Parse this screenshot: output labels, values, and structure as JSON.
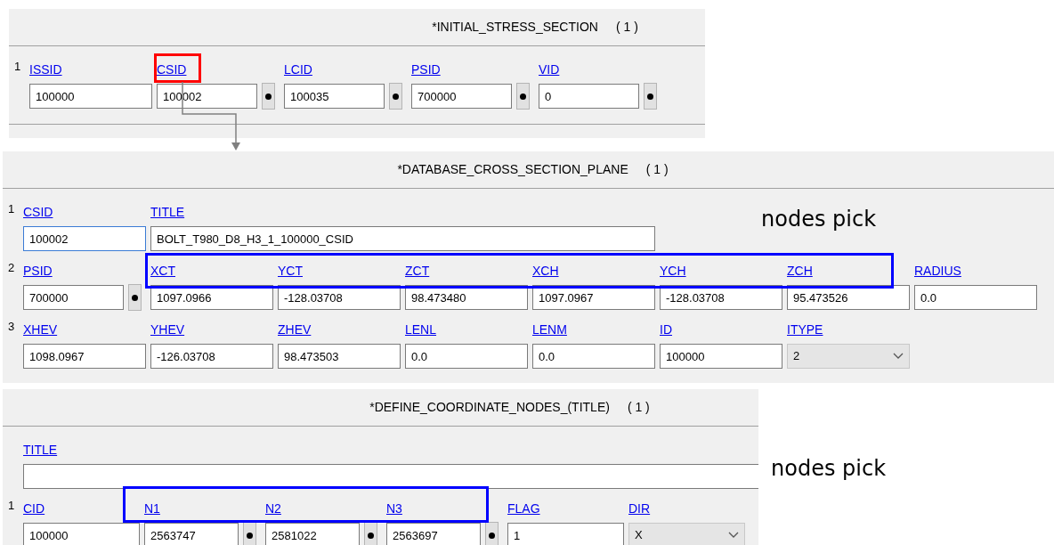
{
  "panels": [
    {
      "title": "*INITIAL_STRESS_SECTION",
      "count": "( 1 )",
      "rows": [
        {
          "number": "1",
          "fields": [
            {
              "label": "ISSID",
              "value": "100000",
              "kind": "text",
              "pick": false
            },
            {
              "label": "CSID",
              "value": "100002",
              "kind": "text",
              "pick": true
            },
            {
              "label": "LCID",
              "value": "100035",
              "kind": "text",
              "pick": true
            },
            {
              "label": "PSID",
              "value": "700000",
              "kind": "text",
              "pick": true
            },
            {
              "label": "VID",
              "value": "0",
              "kind": "text",
              "pick": true
            }
          ]
        }
      ]
    },
    {
      "title": "*DATABASE_CROSS_SECTION_PLANE",
      "count": "( 1 )",
      "rows": [
        {
          "number": "1",
          "fields": [
            {
              "label": "CSID",
              "value": "100002",
              "kind": "text",
              "pick": false,
              "focused": true
            },
            {
              "label": "TITLE",
              "value": "BOLT_T980_D8_H3_1_100000_CSID",
              "kind": "long-text",
              "pick": false
            }
          ]
        },
        {
          "number": "2",
          "fields": [
            {
              "label": "PSID",
              "value": "700000",
              "kind": "text",
              "pick": true
            },
            {
              "label": "XCT",
              "value": "1097.0966",
              "kind": "text",
              "pick": false
            },
            {
              "label": "YCT",
              "value": "-128.03708",
              "kind": "text",
              "pick": false
            },
            {
              "label": "ZCT",
              "value": "98.473480",
              "kind": "text",
              "pick": false
            },
            {
              "label": "XCH",
              "value": "1097.0967",
              "kind": "text",
              "pick": false
            },
            {
              "label": "YCH",
              "value": "-128.03708",
              "kind": "text",
              "pick": false
            },
            {
              "label": "ZCH",
              "value": "95.473526",
              "kind": "text",
              "pick": false
            },
            {
              "label": "RADIUS",
              "value": "0.0",
              "kind": "text",
              "pick": false
            }
          ]
        },
        {
          "number": "3",
          "fields": [
            {
              "label": "XHEV",
              "value": "1098.0967",
              "kind": "text",
              "pick": false
            },
            {
              "label": "YHEV",
              "value": "-126.03708",
              "kind": "text",
              "pick": false
            },
            {
              "label": "ZHEV",
              "value": "98.473503",
              "kind": "text",
              "pick": false
            },
            {
              "label": "LENL",
              "value": "0.0",
              "kind": "text",
              "pick": false
            },
            {
              "label": "LENM",
              "value": "0.0",
              "kind": "text",
              "pick": false
            },
            {
              "label": "ID",
              "value": "100000",
              "kind": "text",
              "pick": false
            },
            {
              "label": "ITYPE",
              "value": "2",
              "kind": "select",
              "pick": false
            }
          ]
        }
      ]
    },
    {
      "title": "*DEFINE_COORDINATE_NODES_(TITLE)",
      "count": "( 1 )",
      "rows": [
        {
          "fields": [
            {
              "label": "TITLE",
              "kind": "long-text",
              "pick": false
            }
          ]
        },
        {
          "number": "1",
          "fields": [
            {
              "label": "CID",
              "value": "100000",
              "kind": "text",
              "pick": false
            },
            {
              "label": "N1",
              "value": "2563747",
              "kind": "text",
              "pick": true
            },
            {
              "label": "N2",
              "value": "2581022",
              "kind": "text",
              "pick": true
            },
            {
              "label": "N3",
              "value": "2563697",
              "kind": "text",
              "pick": true
            },
            {
              "label": "FLAG",
              "value": "1",
              "kind": "text",
              "pick": false
            },
            {
              "label": "DIR",
              "value": "X",
              "kind": "select",
              "pick": false
            }
          ]
        }
      ]
    }
  ],
  "annotations": [
    {
      "text": "nodes pick"
    },
    {
      "text": "nodes pick"
    }
  ]
}
